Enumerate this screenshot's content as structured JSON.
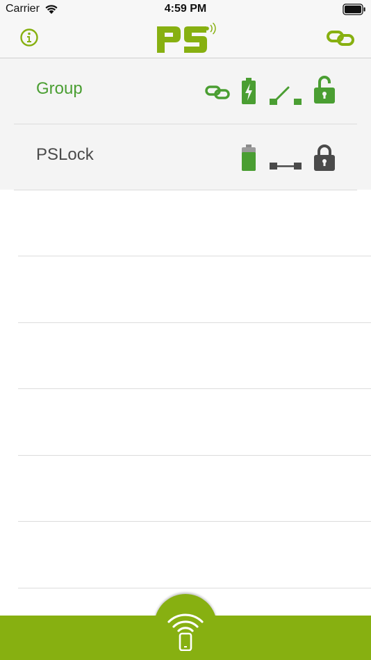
{
  "status_bar": {
    "carrier": "Carrier",
    "time": "4:59 PM",
    "wifi_icon": "wifi-icon",
    "battery_icon": "battery-icon"
  },
  "nav": {
    "logo_text": "PS",
    "info_icon": "info-icon",
    "link_icon": "link-icon"
  },
  "rows": [
    {
      "name": "Group",
      "icons": [
        "link-icon",
        "battery-charging-icon",
        "switch-open-icon",
        "lock-open-icon"
      ],
      "status_color": "#4a9e32"
    },
    {
      "name": "PSLock",
      "icons": [
        "battery-icon",
        "switch-closed-icon",
        "lock-closed-icon"
      ],
      "status_color": "#4a4a4a"
    }
  ],
  "empty_rows": 6,
  "colors": {
    "accent": "#87b011",
    "active_green": "#4a9e32",
    "inactive_gray": "#4a4a4a",
    "list_background": "#f4f4f4"
  },
  "tab_bar": {
    "scan_icon": "scan-bluetooth-phone-icon"
  }
}
